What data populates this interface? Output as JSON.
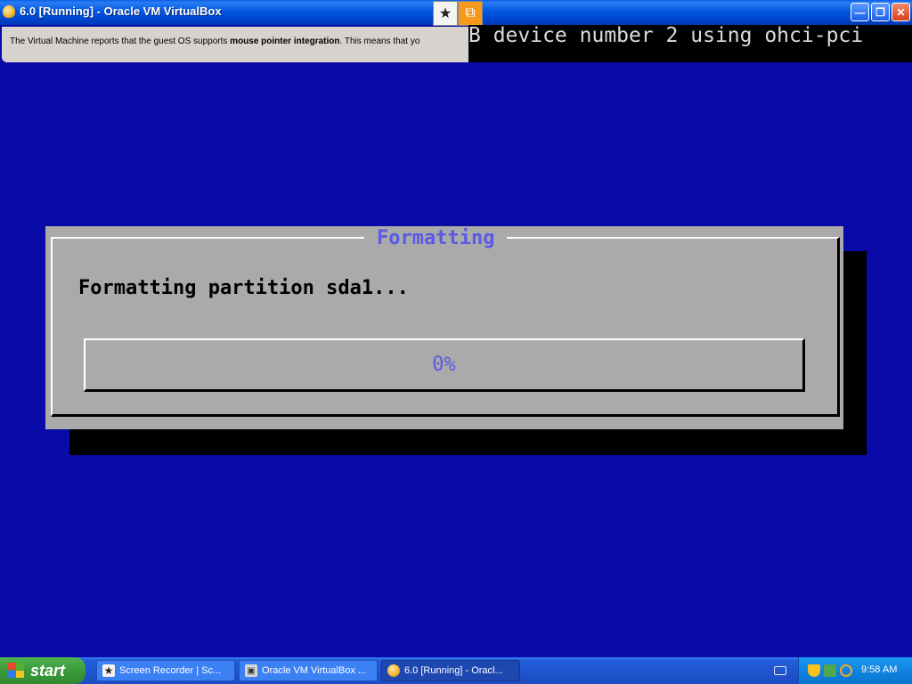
{
  "window": {
    "title": "6.0 [Running] - Oracle VM VirtualBox",
    "minimize_icon": "minimize-icon",
    "maximize_icon": "restore-icon",
    "close_icon": "close-icon"
  },
  "notification": {
    "prefix": "The Virtual Machine reports that the guest OS supports ",
    "bold": "mouse pointer integration",
    "suffix": ". This means that yo"
  },
  "console": {
    "line": "B device number 2 using ohci-pci"
  },
  "dialog": {
    "title": "Formatting",
    "message": "Formatting partition sda1...",
    "progress_label": "0%",
    "progress_value": 0
  },
  "taskbar": {
    "start_label": "start",
    "tasks": [
      {
        "label": "Screen Recorder | Sc...",
        "icon": "recorder-icon"
      },
      {
        "label": "Oracle VM VirtualBox ...",
        "icon": "virtualbox-manager-icon"
      },
      {
        "label": "6.0 [Running] - Oracl...",
        "icon": "virtualbox-vm-icon"
      }
    ],
    "clock": "9:58 AM"
  },
  "colors": {
    "background": "#0a0aa8",
    "dialog": "#aaaaaa",
    "accent": "#5a5ae6"
  }
}
